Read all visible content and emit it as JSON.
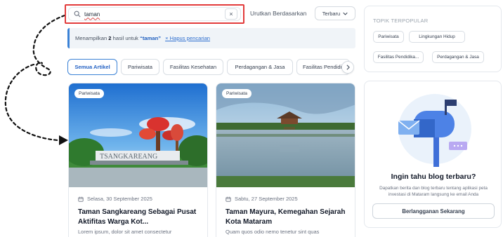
{
  "search": {
    "value": "taman",
    "clear_label": "×"
  },
  "sort": {
    "label": "Urutkan Berdasarkan",
    "selected": "Terbaru"
  },
  "results_banner": {
    "prefix": "Menampilkan",
    "count": "2",
    "middle": "hasil untuk",
    "query": "“taman”",
    "reset_label": "× Hapus pencarian"
  },
  "tabs": [
    {
      "label": "Semua Artikel",
      "active": true
    },
    {
      "label": "Pariwisata",
      "active": false
    },
    {
      "label": "Fasilitas Kesehatan",
      "active": false
    },
    {
      "label": "Perdagangan & Jasa",
      "active": false
    },
    {
      "label": "Fasilitas Pendidi",
      "active": false
    }
  ],
  "articles": [
    {
      "category": "Pariwisata",
      "date": "Selasa, 30 September 2025",
      "title": "Taman Sangkareang Sebagai Pusat Aktifitas Warga Kot...",
      "excerpt": "Lorem ipsum, dolor sit amet consectetur",
      "image": "park-sign-photo"
    },
    {
      "category": "Pariwisata",
      "date": "Sabtu, 27 September 2025",
      "title": "Taman Mayura, Kemegahan Sejarah Kota Mataram",
      "excerpt": "Quam quos odio nemo tenetur sint quas",
      "image": "water-palace-photo"
    }
  ],
  "popular_topics": {
    "heading": "TOPIK TERPOPULAR",
    "items": [
      "Pariwisata",
      "Lingkungan Hidup",
      "Fasilitas Pendidika...",
      "Perdagangan & Jasa"
    ]
  },
  "newsletter": {
    "title": "Ingin tahu blog terbaru?",
    "description": "Dapatkan berita dan blog terbaru tentang aplikasi peta investasi di Mataram langsung ke email Anda",
    "button": "Berlangganan Sekarang",
    "illustration": "mailbox-illustration"
  },
  "colors": {
    "accent": "#3b82d6",
    "highlight": "#e23b3b"
  }
}
